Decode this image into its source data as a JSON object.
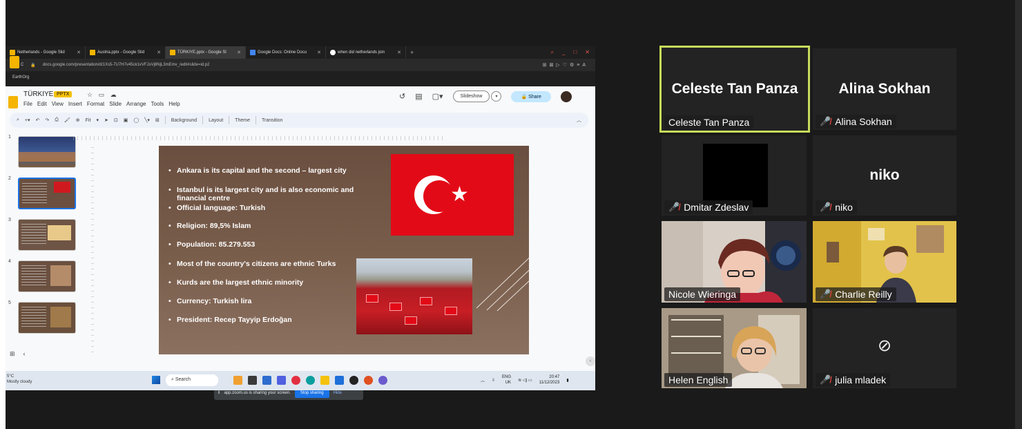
{
  "browser": {
    "tabs": [
      {
        "label": "Netherlands - Google Slid",
        "active": false
      },
      {
        "label": "Austria.pptx - Google Slid",
        "active": false
      },
      {
        "label": "TÜRKIYE.pptx - Google Sl",
        "active": true
      },
      {
        "label": "Google Docs: Online Docu",
        "active": false
      },
      {
        "label": "when did netherlands join",
        "active": false
      }
    ],
    "url": "docs.google.com/presentation/d/1Xs5-7U7H7v45ck1vVFJsVj8NjL3mEmv_/edit#slide=id.p2",
    "bookmark": "EarthOrg"
  },
  "slides_app": {
    "title": "TÜRKIYE",
    "badge": "PPTX",
    "menu": [
      "File",
      "Edit",
      "View",
      "Insert",
      "Format",
      "Slide",
      "Arrange",
      "Tools",
      "Help"
    ],
    "slideshow_label": "Slideshow",
    "share_label": "Share",
    "toolbar": {
      "zoom": "Fit",
      "background": "Background",
      "layout": "Layout",
      "theme": "Theme",
      "transition": "Transition"
    },
    "thumbnails": [
      "1",
      "2",
      "3",
      "4",
      "5"
    ],
    "selected_slide": 2,
    "slide": {
      "bullets": [
        "Ankara is its capital and the second – largest city",
        "Istanbul is its largest city and is also economic and financial centre",
        "Official language: Turkish",
        "Religion: 89,5% Islam",
        "Population: 85.279.553",
        "Most of the country's citizens are ethnic Turks",
        "Kurds are the largest ethnic minority",
        "Currency: Turkish lira",
        "President: Recep Tayyip Erdoğan"
      ]
    },
    "share_banner": {
      "text": "app.zoom.us is sharing your screen.",
      "stop": "Stop sharing",
      "hide": "Hide"
    }
  },
  "taskbar": {
    "weather_temp": "5°C",
    "weather_desc": "Mostly cloudy",
    "search": "Search",
    "lang": "ENG",
    "region": "UK",
    "time": "20:47",
    "date": "11/12/2023"
  },
  "participants": [
    {
      "name": "Celeste Tan Panza",
      "display": "Celeste Tan Panza",
      "muted": false,
      "video": false,
      "active": true
    },
    {
      "name": "Alina Sokhan",
      "display": "Alina Sokhan",
      "muted": true,
      "video": false,
      "active": false
    },
    {
      "name": "Dmitar Zdeslav",
      "display": "",
      "muted": true,
      "video": false,
      "active": false
    },
    {
      "name": "niko",
      "display": "niko",
      "muted": true,
      "video": false,
      "active": false
    },
    {
      "name": "Nicole Wieringa",
      "display": "",
      "muted": false,
      "video": true,
      "active": false
    },
    {
      "name": "Charlie Reilly",
      "display": "",
      "muted": true,
      "video": true,
      "active": false
    },
    {
      "name": "Helen English",
      "display": "",
      "muted": false,
      "video": true,
      "active": false
    },
    {
      "name": "julia mladek",
      "display": "",
      "muted": true,
      "video": false,
      "active": false
    }
  ],
  "icons": {
    "mic_muted": "microphone-slash-icon",
    "camera_off": "video-off-icon"
  },
  "colors": {
    "active_speaker_border": "#c6dc5a",
    "mic_muted": "#e0433a",
    "turkish_red": "#e30a17",
    "stop_sharing": "#1a73e8"
  }
}
